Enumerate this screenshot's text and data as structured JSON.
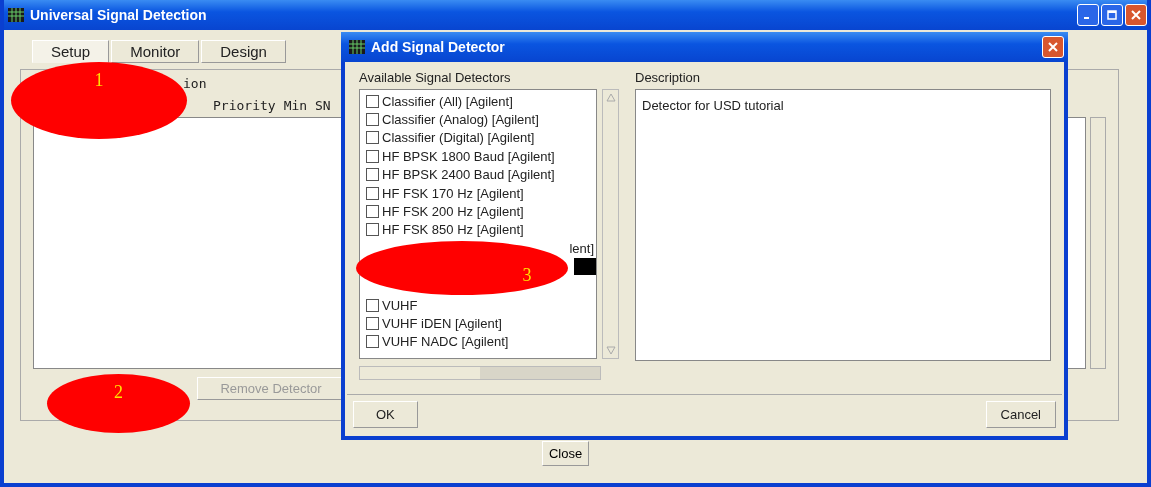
{
  "window": {
    "title": "Universal Signal Detection"
  },
  "tabs": [
    {
      "label": "Setup",
      "selected": true
    },
    {
      "label": "Monitor",
      "selected": false
    },
    {
      "label": "Design",
      "selected": false
    }
  ],
  "section_fragment": "ion",
  "columns": [
    "Priority",
    "Min SN"
  ],
  "buttons": [
    {
      "label": "Remove Detector",
      "disabled": true
    }
  ],
  "close_button": "Close",
  "dialog": {
    "title": "Add Signal Detector",
    "list_label": "Available Signal Detectors",
    "items": [
      {
        "kind": "item",
        "label": "Classifier (All) [Agilent]",
        "checked": false,
        "selected": false
      },
      {
        "kind": "item",
        "label": "Classifier (Analog) [Agilent]",
        "checked": false,
        "selected": false
      },
      {
        "kind": "item",
        "label": "Classifier (Digital) [Agilent]",
        "checked": false,
        "selected": false
      },
      {
        "kind": "item",
        "label": "HF BPSK 1800 Baud [Agilent]",
        "checked": false,
        "selected": false
      },
      {
        "kind": "item",
        "label": "HF BPSK 2400 Baud [Agilent]",
        "checked": false,
        "selected": false
      },
      {
        "kind": "item",
        "label": "HF FSK 170 Hz [Agilent]",
        "checked": false,
        "selected": false
      },
      {
        "kind": "item",
        "label": "HF FSK 200 Hz [Agilent]",
        "checked": false,
        "selected": false
      },
      {
        "kind": "item",
        "label": "HF FSK 850 Hz [Agilent]",
        "checked": false,
        "selected": false
      },
      {
        "kind": "fragment",
        "label": "lent]",
        "selected": false
      },
      {
        "kind": "highlight",
        "selected": true
      },
      {
        "kind": "item",
        "label": "VUHF",
        "checked": false,
        "selected": false
      },
      {
        "kind": "item",
        "label": "VUHF iDEN [Agilent]",
        "checked": false,
        "selected": false
      },
      {
        "kind": "item",
        "label": "VUHF NADC [Agilent]",
        "checked": false,
        "selected": false
      }
    ],
    "description_label": "Description",
    "description": "Detector for USD tutorial",
    "ok": "OK",
    "cancel": "Cancel"
  },
  "annotations": [
    {
      "label": "1"
    },
    {
      "label": "2"
    },
    {
      "label": "3"
    }
  ]
}
